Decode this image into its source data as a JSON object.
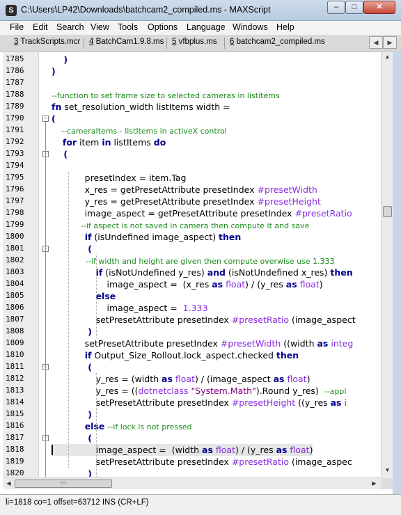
{
  "window": {
    "title": "C:\\Users\\LP42\\Downloads\\batchcam2_compiled.ms - MAXScript",
    "app_icon": "maxscript-logo-icon",
    "minimize_glyph": "–",
    "maximize_glyph": "□",
    "close_glyph": "✕"
  },
  "menu": [
    "File",
    "Edit",
    "Search",
    "View",
    "Tools",
    "Options",
    "Language",
    "Windows",
    "Help"
  ],
  "tabs": [
    {
      "num": "3",
      "label": " TrackScripts.mcr"
    },
    {
      "num": "4",
      "label": " BatchCam1.9.8.ms"
    },
    {
      "num": "5",
      "label": " vfbplus.ms"
    },
    {
      "num": "6",
      "label": " batchcam2_compiled.ms"
    }
  ],
  "tab_nav": {
    "prev": "◀",
    "next": "▶"
  },
  "editor": {
    "current_line": "1818",
    "lines": [
      {
        "n": "1785",
        "fold": "",
        "segs": [
          {
            "t": "    )",
            "c": "kw"
          }
        ]
      },
      {
        "n": "1786",
        "fold": "",
        "segs": [
          {
            "t": ")",
            "c": "kw"
          }
        ]
      },
      {
        "n": "1787",
        "fold": "",
        "segs": []
      },
      {
        "n": "1788",
        "fold": "",
        "segs": [
          {
            "t": "--function to set frame size to selected cameras in listitems",
            "c": "cm"
          }
        ]
      },
      {
        "n": "1789",
        "fold": "",
        "segs": [
          {
            "t": "fn",
            "c": "kw"
          },
          {
            "t": " set_resolution_width listItems width =",
            "c": ""
          }
        ]
      },
      {
        "n": "1790",
        "fold": "-",
        "segs": [
          {
            "t": "(",
            "c": "kw"
          }
        ]
      },
      {
        "n": "1791",
        "fold": "",
        "segs": [
          {
            "t": "    --cameraItems - listItems in activeX control",
            "c": "cm"
          }
        ]
      },
      {
        "n": "1792",
        "fold": "",
        "segs": [
          {
            "t": "    ",
            "c": ""
          },
          {
            "t": "for",
            "c": "kw"
          },
          {
            "t": " item ",
            "c": ""
          },
          {
            "t": "in",
            "c": "kw"
          },
          {
            "t": " listItems ",
            "c": ""
          },
          {
            "t": "do",
            "c": "kw"
          }
        ]
      },
      {
        "n": "1793",
        "fold": "-",
        "segs": [
          {
            "t": "    (",
            "c": "kw"
          }
        ]
      },
      {
        "n": "1794",
        "fold": "",
        "segs": []
      },
      {
        "n": "1795",
        "fold": "",
        "segs": [
          {
            "t": "            presetIndex = item.Tag",
            "c": ""
          }
        ]
      },
      {
        "n": "1796",
        "fold": "",
        "segs": [
          {
            "t": "            x_res = getPresetAttribute presetIndex ",
            "c": ""
          },
          {
            "t": "#presetWidth",
            "c": "nm"
          }
        ]
      },
      {
        "n": "1797",
        "fold": "",
        "segs": [
          {
            "t": "            y_res = getPresetAttribute presetIndex ",
            "c": ""
          },
          {
            "t": "#presetHeight",
            "c": "nm"
          }
        ]
      },
      {
        "n": "1798",
        "fold": "",
        "segs": [
          {
            "t": "            image_aspect = getPresetAttribute presetIndex ",
            "c": ""
          },
          {
            "t": "#presetRatio",
            "c": "nm"
          }
        ]
      },
      {
        "n": "1799",
        "fold": "",
        "segs": [
          {
            "t": "            --if aspect is not saved in camera then compute it and save",
            "c": "cm"
          }
        ]
      },
      {
        "n": "1800",
        "fold": "",
        "segs": [
          {
            "t": "            ",
            "c": ""
          },
          {
            "t": "if",
            "c": "kw"
          },
          {
            "t": " (isUndefined image_aspect) ",
            "c": ""
          },
          {
            "t": "then",
            "c": "kw"
          }
        ]
      },
      {
        "n": "1801",
        "fold": "-",
        "segs": [
          {
            "t": "            (",
            "c": "kw"
          }
        ]
      },
      {
        "n": "1802",
        "fold": "",
        "segs": [
          {
            "t": "              --if width and height are given then compute overwise use 1.333",
            "c": "cm"
          }
        ]
      },
      {
        "n": "1803",
        "fold": "",
        "segs": [
          {
            "t": "                ",
            "c": ""
          },
          {
            "t": "if",
            "c": "kw"
          },
          {
            "t": " (isNotUndefined y_res) ",
            "c": ""
          },
          {
            "t": "and",
            "c": "kw"
          },
          {
            "t": " (isNotUndefined x_res) ",
            "c": ""
          },
          {
            "t": "then",
            "c": "kw"
          }
        ]
      },
      {
        "n": "1804",
        "fold": "",
        "segs": [
          {
            "t": "                    image_aspect =  (x_res ",
            "c": ""
          },
          {
            "t": "as",
            "c": "kw"
          },
          {
            "t": " ",
            "c": ""
          },
          {
            "t": "float",
            "c": "lit"
          },
          {
            "t": ") / (y_res ",
            "c": ""
          },
          {
            "t": "as",
            "c": "kw"
          },
          {
            "t": " ",
            "c": ""
          },
          {
            "t": "float",
            "c": "lit"
          },
          {
            "t": ")",
            "c": ""
          }
        ]
      },
      {
        "n": "1805",
        "fold": "",
        "segs": [
          {
            "t": "                ",
            "c": ""
          },
          {
            "t": "else",
            "c": "kw"
          }
        ]
      },
      {
        "n": "1806",
        "fold": "",
        "segs": [
          {
            "t": "                    image_aspect =  ",
            "c": ""
          },
          {
            "t": "1.333",
            "c": "lit"
          }
        ]
      },
      {
        "n": "1807",
        "fold": "",
        "segs": [
          {
            "t": "                setPresetAttribute presetIndex ",
            "c": ""
          },
          {
            "t": "#presetRatio",
            "c": "nm"
          },
          {
            "t": " (image_aspect",
            "c": ""
          }
        ]
      },
      {
        "n": "1808",
        "fold": "",
        "segs": [
          {
            "t": "            )",
            "c": "kw"
          }
        ]
      },
      {
        "n": "1809",
        "fold": "",
        "segs": [
          {
            "t": "            setPresetAttribute presetIndex ",
            "c": ""
          },
          {
            "t": "#presetWidth",
            "c": "nm"
          },
          {
            "t": " ((width ",
            "c": ""
          },
          {
            "t": "as",
            "c": "kw"
          },
          {
            "t": " ",
            "c": ""
          },
          {
            "t": "integ",
            "c": "lit"
          }
        ]
      },
      {
        "n": "1810",
        "fold": "",
        "segs": [
          {
            "t": "            ",
            "c": ""
          },
          {
            "t": "if",
            "c": "kw"
          },
          {
            "t": " Output_Size_Rollout.lock_aspect.checked ",
            "c": ""
          },
          {
            "t": "then",
            "c": "kw"
          }
        ]
      },
      {
        "n": "1811",
        "fold": "-",
        "segs": [
          {
            "t": "            (",
            "c": "kw"
          }
        ]
      },
      {
        "n": "1812",
        "fold": "",
        "segs": [
          {
            "t": "                y_res = (width ",
            "c": ""
          },
          {
            "t": "as",
            "c": "kw"
          },
          {
            "t": " ",
            "c": ""
          },
          {
            "t": "float",
            "c": "lit"
          },
          {
            "t": ") / (image_aspect ",
            "c": ""
          },
          {
            "t": "as",
            "c": "kw"
          },
          {
            "t": " ",
            "c": ""
          },
          {
            "t": "float",
            "c": "lit"
          },
          {
            "t": ")",
            "c": ""
          }
        ]
      },
      {
        "n": "1813",
        "fold": "",
        "segs": [
          {
            "t": "                y_res = ((",
            "c": ""
          },
          {
            "t": "dotnetclass",
            "c": "lit"
          },
          {
            "t": " ",
            "c": ""
          },
          {
            "t": "\"System.Math\"",
            "c": "st"
          },
          {
            "t": ").Round y_res)  ",
            "c": ""
          },
          {
            "t": "--appl",
            "c": "cm"
          }
        ]
      },
      {
        "n": "1814",
        "fold": "",
        "segs": [
          {
            "t": "                setPresetAttribute presetIndex ",
            "c": ""
          },
          {
            "t": "#presetHeight",
            "c": "nm"
          },
          {
            "t": " ((y_res ",
            "c": ""
          },
          {
            "t": "as",
            "c": "kw"
          },
          {
            "t": " i",
            "c": "lit"
          }
        ]
      },
      {
        "n": "1815",
        "fold": "",
        "segs": [
          {
            "t": "            )",
            "c": "kw"
          }
        ]
      },
      {
        "n": "1816",
        "fold": "",
        "segs": [
          {
            "t": "            ",
            "c": ""
          },
          {
            "t": "else",
            "c": "kw"
          },
          {
            "t": " ",
            "c": ""
          },
          {
            "t": "--if lock is not pressed",
            "c": "cm"
          }
        ]
      },
      {
        "n": "1817",
        "fold": "-",
        "segs": [
          {
            "t": "            (",
            "c": "kw"
          }
        ]
      },
      {
        "n": "1818",
        "fold": "",
        "segs": [
          {
            "t": "                image_aspect =  (width ",
            "c": ""
          },
          {
            "t": "as",
            "c": "kw"
          },
          {
            "t": " ",
            "c": ""
          },
          {
            "t": "float",
            "c": "lit"
          },
          {
            "t": ") / (y_res ",
            "c": ""
          },
          {
            "t": "as",
            "c": "kw"
          },
          {
            "t": " ",
            "c": ""
          },
          {
            "t": "float",
            "c": "lit"
          },
          {
            "t": ")",
            "c": ""
          }
        ]
      },
      {
        "n": "1819",
        "fold": "",
        "segs": [
          {
            "t": "                setPresetAttribute presetIndex ",
            "c": ""
          },
          {
            "t": "#presetRatio",
            "c": "nm"
          },
          {
            "t": " (image_aspec",
            "c": ""
          }
        ]
      },
      {
        "n": "1820",
        "fold": "",
        "segs": [
          {
            "t": "            )",
            "c": "kw"
          }
        ]
      }
    ]
  },
  "scrollbars": {
    "up_arrow": "▲",
    "down_arrow": "▼",
    "left_arrow": "◀",
    "right_arrow": "▶",
    "h_thumb_grip": "III"
  },
  "status": {
    "text": "li=1818 co=1 offset=63712 INS (CR+LF)"
  }
}
